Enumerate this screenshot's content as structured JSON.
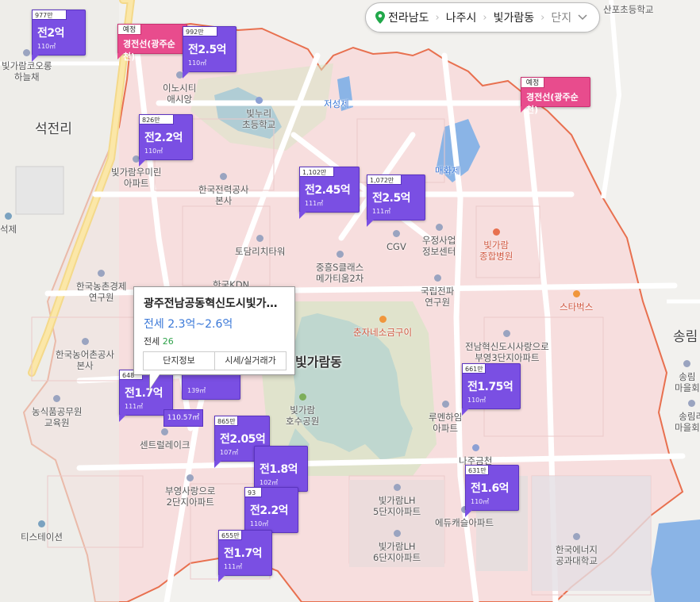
{
  "breadcrumb": {
    "province": "전라남도",
    "city": "나주시",
    "dong": "빛가람동",
    "complex": "단지"
  },
  "neighborhood_label": "빛가람동",
  "district_labels": {
    "seokjeon": "석전리",
    "songrim": "송림"
  },
  "places": {
    "p1": "빛가람코오롱\n하늘채",
    "p2": "이노시티\n애시앙",
    "p3": "빛누리\n초등학교",
    "p4": "저성제",
    "p5": "빛가람우미린\n아파트",
    "p6": "한국전력공사\n본사",
    "p7": "매화제",
    "p8": "한국농촌경제\n연구원",
    "p9": "토담리치타워",
    "p10": "CGV",
    "p11": "중흥S클래스\n메가티움2차",
    "p12": "우정사업\n정보센터",
    "p13": "빛가람\n종합병원",
    "p14": "국립전파\n연구원",
    "p15": "스타벅스",
    "p16": "한국농어촌공사\n본사",
    "p17": "춘자네소금구이",
    "p18": "전남혁신도시사랑으로\n부영3단지아파트",
    "p19": "농식품공무원\n교육원",
    "p20": "빛가람\n호수공원",
    "p21": "루멘하임\n아파트",
    "p22": "센트럴레이크",
    "p23": "나주금천",
    "p24": "부영사랑으로\n2단지아파트",
    "p25": "빛가람LH\n5단지아파트",
    "p26": "에듀캐슬아파트",
    "p27": "티스테이션",
    "p28": "빛가람LH\n6단지아파트",
    "p29": "한국에너지\n공과대학교",
    "p30": "산포초등학교",
    "p31": "석제",
    "p32": "송림\n마을회",
    "p33": "송림리\n마을회관",
    "p34": "한국KDN"
  },
  "markers": [
    {
      "top": "977만",
      "price": "전2억",
      "area": "110㎡"
    },
    {
      "top": "992만",
      "price": "전2.5억",
      "area": "110㎡"
    },
    {
      "top": "826만",
      "price": "전2.2억",
      "area": "110㎡"
    },
    {
      "top": "1,102만",
      "price": "전2.45억",
      "area": "111㎡"
    },
    {
      "top": "1,072만",
      "price": "전2.5억",
      "area": "111㎡"
    },
    {
      "top": "648",
      "price": "전1.7억",
      "area": "111㎡"
    },
    {
      "top": "",
      "price": "",
      "area": "139㎡"
    },
    {
      "top": "661만",
      "price": "전1.75억",
      "area": "110㎡"
    },
    {
      "top": "865만",
      "price": "전2.05억",
      "area": "107㎡"
    },
    {
      "top": "",
      "price": "전1.8억",
      "area": "102㎡"
    },
    {
      "top": "631만",
      "price": "전1.6억",
      "area": "110㎡"
    },
    {
      "top": "93",
      "price": "전2.2억",
      "area": "110㎡"
    },
    {
      "top": "655만",
      "price": "전1.7억",
      "area": "111㎡"
    }
  ],
  "small_area_label": "110.57㎡",
  "plan_badges": [
    {
      "tag": "예정",
      "name": "경전선(광주순천)"
    },
    {
      "tag": "예정",
      "name": "경전선(광주순천)"
    }
  ],
  "popup": {
    "title": "광주전남공동혁신도시빛가…",
    "range": "전세 2.3억~2.6억",
    "count_label": "전세",
    "count_value": "26",
    "btn_info": "단지정보",
    "btn_price": "시세/실거래가"
  },
  "colors": {
    "marker": "#7a4fe3",
    "plan": "#e84c8d",
    "boundary": "#e8704f",
    "zone": "#f6dcdc",
    "water": "#8ab4e6",
    "park": "#d5e6c4"
  }
}
